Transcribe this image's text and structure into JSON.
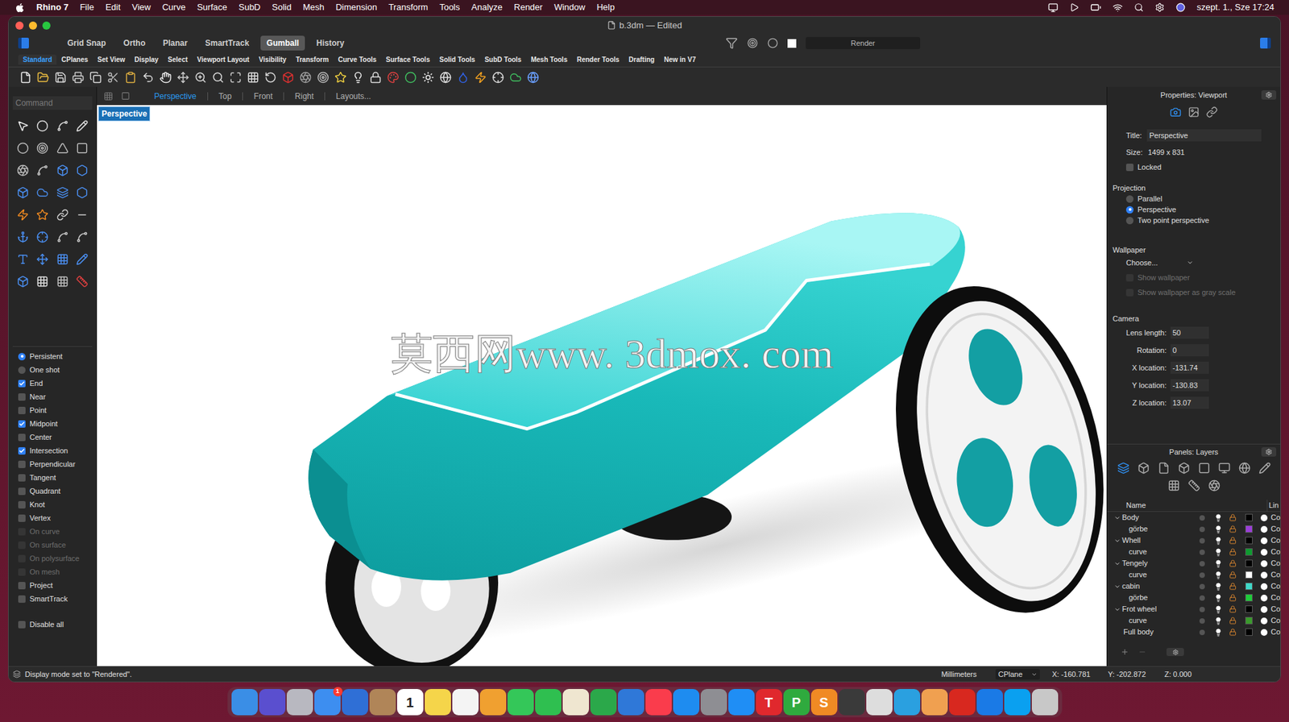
{
  "menubar": {
    "app": "Rhino 7",
    "items": [
      "File",
      "Edit",
      "View",
      "Curve",
      "Surface",
      "SubD",
      "Solid",
      "Mesh",
      "Dimension",
      "Transform",
      "Tools",
      "Analyze",
      "Render",
      "Window",
      "Help"
    ],
    "clock": "szept. 1., Sze 17:24"
  },
  "window": {
    "title": "b.3dm — Edited"
  },
  "toolbar": {
    "toggles": [
      {
        "label": "Grid Snap",
        "selected": false
      },
      {
        "label": "Ortho",
        "selected": false
      },
      {
        "label": "Planar",
        "selected": false
      },
      {
        "label": "SmartTrack",
        "selected": false
      },
      {
        "label": "Gumball",
        "selected": true
      },
      {
        "label": "History",
        "selected": false
      }
    ],
    "render_button": "Render"
  },
  "ribbon_tabs": [
    {
      "label": "Standard",
      "selected": true
    },
    {
      "label": "CPlanes",
      "selected": false
    },
    {
      "label": "Set View",
      "selected": false
    },
    {
      "label": "Display",
      "selected": false
    },
    {
      "label": "Select",
      "selected": false
    },
    {
      "label": "Viewport Layout",
      "selected": false
    },
    {
      "label": "Visibility",
      "selected": false
    },
    {
      "label": "Transform",
      "selected": false
    },
    {
      "label": "Curve Tools",
      "selected": false
    },
    {
      "label": "Surface Tools",
      "selected": false
    },
    {
      "label": "Solid Tools",
      "selected": false
    },
    {
      "label": "SubD Tools",
      "selected": false
    },
    {
      "label": "Mesh Tools",
      "selected": false
    },
    {
      "label": "Render Tools",
      "selected": false
    },
    {
      "label": "Drafting",
      "selected": false
    },
    {
      "label": "New in V7",
      "selected": false
    }
  ],
  "command": {
    "placeholder": "Command"
  },
  "viewport_tabs": [
    {
      "label": "Perspective",
      "selected": true
    },
    {
      "label": "Top",
      "selected": false
    },
    {
      "label": "Front",
      "selected": false
    },
    {
      "label": "Right",
      "selected": false
    },
    {
      "label": "Layouts...",
      "selected": false
    }
  ],
  "viewport": {
    "label": "Perspective",
    "watermark": "莫西网www. 3dmox. com"
  },
  "osnap": {
    "mode": [
      {
        "label": "Persistent",
        "selected": true
      },
      {
        "label": "One shot",
        "selected": false
      }
    ],
    "items": [
      {
        "label": "End",
        "checked": true,
        "disabled": false
      },
      {
        "label": "Near",
        "checked": false,
        "disabled": false
      },
      {
        "label": "Point",
        "checked": false,
        "disabled": false
      },
      {
        "label": "Midpoint",
        "checked": true,
        "disabled": false
      },
      {
        "label": "Center",
        "checked": false,
        "disabled": false
      },
      {
        "label": "Intersection",
        "checked": true,
        "disabled": false
      },
      {
        "label": "Perpendicular",
        "checked": false,
        "disabled": false
      },
      {
        "label": "Tangent",
        "checked": false,
        "disabled": false
      },
      {
        "label": "Quadrant",
        "checked": false,
        "disabled": false
      },
      {
        "label": "Knot",
        "checked": false,
        "disabled": false
      },
      {
        "label": "Vertex",
        "checked": false,
        "disabled": false
      },
      {
        "label": "On curve",
        "checked": false,
        "disabled": true
      },
      {
        "label": "On surface",
        "checked": false,
        "disabled": true
      },
      {
        "label": "On polysurface",
        "checked": false,
        "disabled": true
      },
      {
        "label": "On mesh",
        "checked": false,
        "disabled": true
      },
      {
        "label": "Project",
        "checked": false,
        "disabled": false
      },
      {
        "label": "SmartTrack",
        "checked": false,
        "disabled": false
      }
    ],
    "disable_all": {
      "label": "Disable all",
      "checked": false
    }
  },
  "properties": {
    "header": "Properties: Viewport",
    "title_label": "Title:",
    "title_value": "Perspective",
    "size_label": "Size:",
    "size_value": "1499 x 831",
    "locked": {
      "label": "Locked",
      "checked": false
    },
    "projection": {
      "heading": "Projection",
      "options": [
        {
          "label": "Parallel",
          "selected": false
        },
        {
          "label": "Perspective",
          "selected": true
        },
        {
          "label": "Two point perspective",
          "selected": false
        }
      ]
    },
    "wallpaper": {
      "heading": "Wallpaper",
      "choose": "Choose...",
      "options": [
        {
          "label": "Show wallpaper",
          "checked": false,
          "disabled": true
        },
        {
          "label": "Show wallpaper as gray scale",
          "checked": false,
          "disabled": true
        }
      ]
    },
    "camera": {
      "heading": "Camera",
      "fields": [
        {
          "label": "Lens length:",
          "value": "50"
        },
        {
          "label": "Rotation:",
          "value": "0"
        },
        {
          "label": "X location:",
          "value": "-131.74"
        },
        {
          "label": "Y location:",
          "value": "-130.83"
        },
        {
          "label": "Z location:",
          "value": "13.07"
        }
      ]
    }
  },
  "layers": {
    "header": "Panels: Layers",
    "columns": [
      "Name",
      "Lin"
    ],
    "rows": [
      {
        "name": "Body",
        "kind": "group",
        "expanded": true,
        "color": "#000000",
        "material": "Co"
      },
      {
        "name": "görbe",
        "kind": "child",
        "color": "#9b3fd8",
        "material": "Co"
      },
      {
        "name": "Whell",
        "kind": "group",
        "expanded": true,
        "color": "#000000",
        "material": "Co"
      },
      {
        "name": "curve",
        "kind": "child",
        "color": "#0f9a30",
        "material": "Co"
      },
      {
        "name": "Tengely",
        "kind": "group",
        "expanded": true,
        "color": "#000000",
        "material": "Co"
      },
      {
        "name": "curve",
        "kind": "child",
        "color": "#ffffff",
        "material": "Co"
      },
      {
        "name": "cabin",
        "kind": "group",
        "expanded": true,
        "color": "#3fd8c8",
        "material": "Co"
      },
      {
        "name": "görbe",
        "kind": "child",
        "color": "#1fcb3a",
        "material": "Co"
      },
      {
        "name": "Frot wheel",
        "kind": "group",
        "expanded": true,
        "color": "#000000",
        "material": "Co"
      },
      {
        "name": "curve",
        "kind": "child",
        "color": "#3a9a2c",
        "material": "Co"
      },
      {
        "name": "Full body",
        "kind": "leaf",
        "color": "#000000",
        "material": "Co"
      }
    ]
  },
  "status_bar": {
    "message": "Display mode set to \"Rendered\".",
    "units": "Millimeters",
    "cplane": "CPlane",
    "x": "X: -160.781",
    "y": "Y: -202.872",
    "z": "Z: 0.000"
  },
  "dock": [
    {
      "color": "#3a8ee6",
      "label": ""
    },
    {
      "color": "#5a4fcf",
      "label": ""
    },
    {
      "color": "#b8b8c0",
      "label": ""
    },
    {
      "color": "#3d8ef0",
      "label": "",
      "badge": "1"
    },
    {
      "color": "#2f6fd6",
      "label": ""
    },
    {
      "color": "#b08558",
      "label": ""
    },
    {
      "color": "#ffffff",
      "label": "1"
    },
    {
      "color": "#f5d54a",
      "label": ""
    },
    {
      "color": "#f4f4f4",
      "label": ""
    },
    {
      "color": "#f0a030",
      "label": ""
    },
    {
      "color": "#34c759",
      "label": ""
    },
    {
      "color": "#2fbf50",
      "label": ""
    },
    {
      "color": "#efe6d0",
      "label": ""
    },
    {
      "color": "#2ba84a",
      "label": ""
    },
    {
      "color": "#2f78d8",
      "label": ""
    },
    {
      "color": "#fa3c4c",
      "label": ""
    },
    {
      "color": "#1e8cf0",
      "label": ""
    },
    {
      "color": "#8e8e93",
      "label": ""
    },
    {
      "color": "#1f8ef5",
      "label": ""
    },
    {
      "color": "#e0282d",
      "label": "T"
    },
    {
      "color": "#2faa3e",
      "label": "P"
    },
    {
      "color": "#f08a24",
      "label": "S"
    },
    {
      "color": "#3a3a3a",
      "label": ""
    },
    {
      "color": "#dddddd",
      "label": ""
    },
    {
      "color": "#2aa0e0",
      "label": ""
    },
    {
      "color": "#f0a050",
      "label": ""
    },
    {
      "color": "#d8281f",
      "label": ""
    },
    {
      "color": "#1a7ae6",
      "label": ""
    },
    {
      "color": "#0aa0f0",
      "label": ""
    },
    {
      "color": "#c8c8c8",
      "label": ""
    }
  ]
}
